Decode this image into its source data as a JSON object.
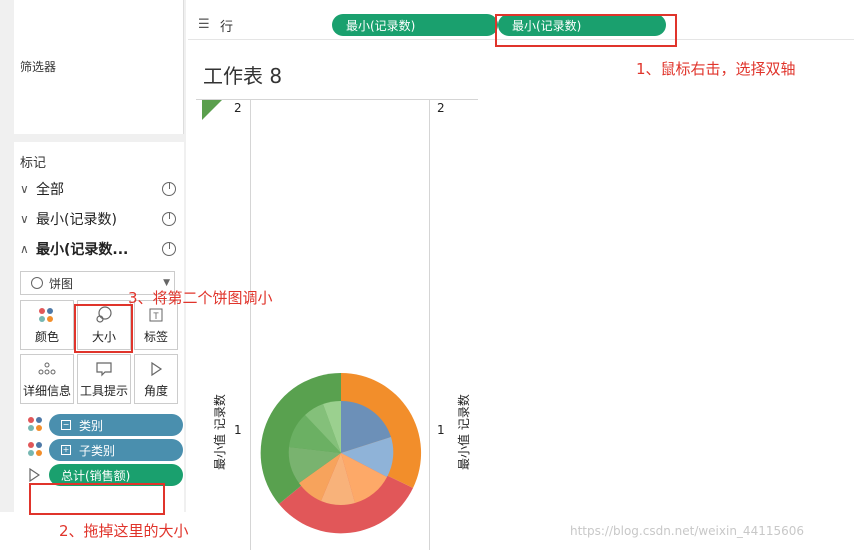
{
  "shelf": {
    "label": "行",
    "pills": [
      "最小(记录数)",
      "最小(记录数)"
    ]
  },
  "filters": {
    "title": "筛选器"
  },
  "marks": {
    "title": "标记",
    "rows": [
      {
        "label": "全部",
        "chev": "∨"
      },
      {
        "label": "最小(记录数)",
        "chev": "∨"
      },
      {
        "label": "最小(记录数...",
        "chev": "∧"
      }
    ],
    "mark_type": "饼图",
    "cards": [
      "颜色",
      "大小",
      "标签",
      "详细信息",
      "工具提示",
      "角度"
    ],
    "fields": [
      {
        "label": "类别",
        "sign": "−"
      },
      {
        "label": "子类别",
        "sign": "+"
      },
      {
        "label": "总计(销售额)"
      }
    ]
  },
  "worksheet": {
    "title": "工作表 8",
    "ticks_left": [
      "2",
      "1"
    ],
    "ticks_right": [
      "2",
      "1"
    ],
    "axis_title": "最小值 记录数"
  },
  "annotations": [
    "1、鼠标右击，选择双轴",
    "3、将第二个饼图调小",
    "2、拖掉这里的大小"
  ],
  "watermark": "https://blog.csdn.net/weixin_44115606",
  "colors": {
    "accent": "#e0342b",
    "green_pill": "#1aa06e",
    "blue_pill": "#4a8fae"
  }
}
